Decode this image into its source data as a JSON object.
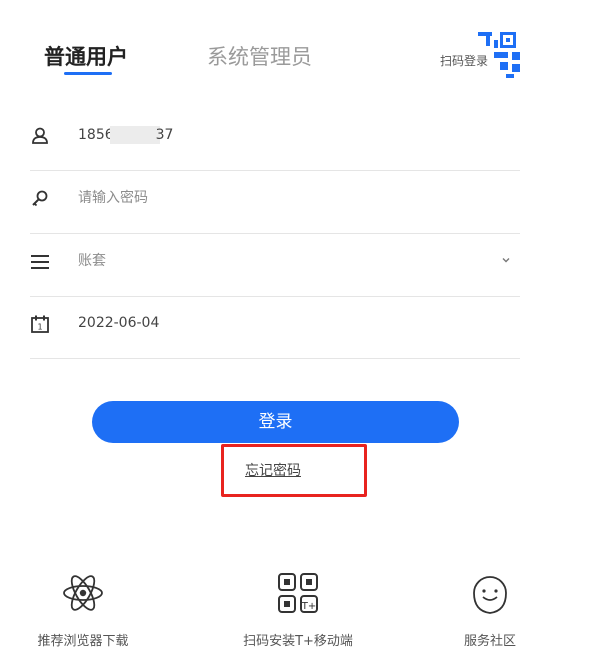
{
  "tabs": {
    "user": "普通用户",
    "admin": "系统管理员"
  },
  "qr_login": {
    "label": "扫码登录"
  },
  "form": {
    "phone_prefix": "1856",
    "phone_suffix": "37",
    "password_placeholder": "请输入密码",
    "account_placeholder": "账套",
    "date_value": "2022-06-04"
  },
  "login_button": "登录",
  "forgot_password": "忘记密码",
  "footer": {
    "browser_download": "推荐浏览器下载",
    "scan_install": "扫码安装T+移动端",
    "community": "服务社区"
  },
  "colors": {
    "primary": "#1e6ff5",
    "highlight": "#e8231f"
  }
}
